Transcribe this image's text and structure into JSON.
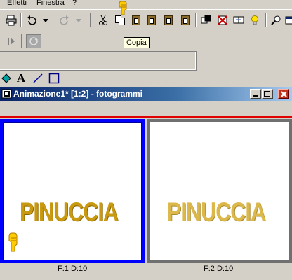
{
  "menu": {
    "items": [
      "Effetti",
      "Finestra",
      "?"
    ]
  },
  "toolbar": {
    "tooltip": "Copia"
  },
  "window": {
    "title": "Animazione1* [1:2] - fotogrammi",
    "frames": [
      {
        "label": "F:1  D:10",
        "text": "PINUCCIA"
      },
      {
        "label": "F:2  D:10",
        "text": "PINUCCIA"
      }
    ]
  },
  "colors": {
    "accent_title_start": "#0a246a",
    "accent_title_end": "#a6caf0",
    "close_button": "#c1301a",
    "text_gold": "#c99a10"
  }
}
